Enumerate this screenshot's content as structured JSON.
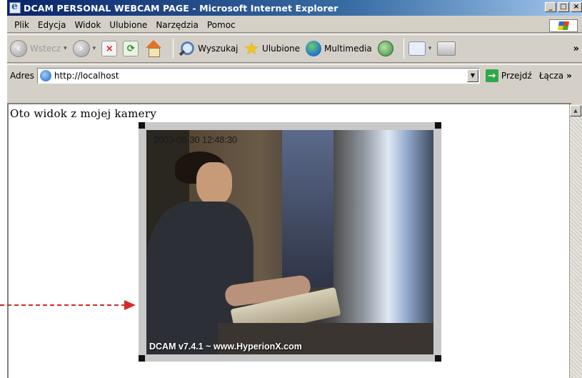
{
  "window": {
    "title": "DCAM PERSONAL WEBCAM PAGE - Microsoft Internet Explorer",
    "controls": [
      "_",
      "□",
      "×"
    ]
  },
  "menu": [
    "Plik",
    "Edycja",
    "Widok",
    "Ulubione",
    "Narzędzia",
    "Pomoc"
  ],
  "toolbar": {
    "back_label": "Wstecz",
    "search_label": "Wyszukaj",
    "favorites_label": "Ulubione",
    "media_label": "Multimedia",
    "more": "»"
  },
  "address": {
    "label": "Adres",
    "url": "http://localhost",
    "go_label": "Przejdź",
    "links_label": "Łącza",
    "more": "»"
  },
  "page": {
    "text": "Oto widok z mojej kamery"
  },
  "webcam": {
    "timestamp": "2003-06-30 12:48:30",
    "caption": "DCAM v7.4.1 ~ www.HyperionX.com"
  },
  "colors": {
    "titlebar": "#0a246a",
    "chrome": "#d4d0c8",
    "arrow": "#d22a2a"
  }
}
